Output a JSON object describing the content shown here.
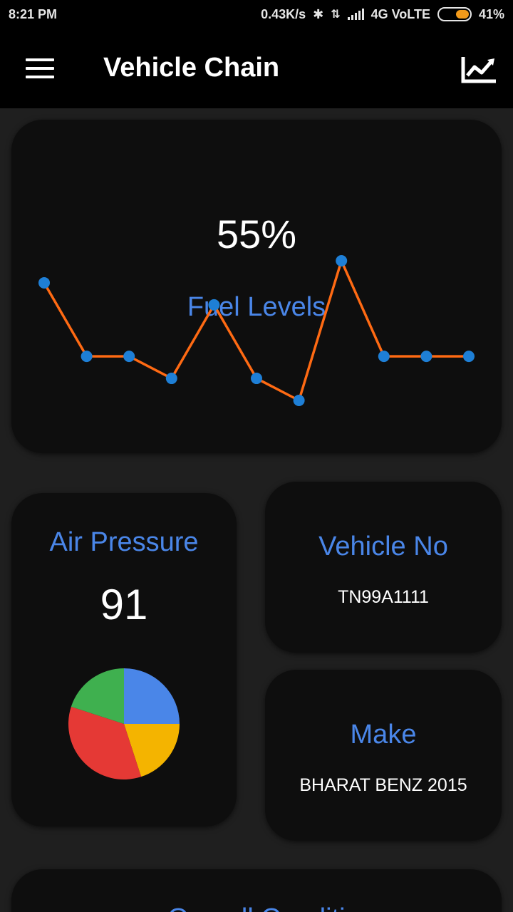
{
  "status_bar": {
    "time": "8:21 PM",
    "network_speed": "0.43K/s",
    "network_type": "4G VoLTE",
    "battery_percent": "41%"
  },
  "app_bar": {
    "title": "Vehicle Chain",
    "menu_icon": "hamburger-menu-icon",
    "chart_icon": "trending-chart-icon"
  },
  "fuel": {
    "title": "Fuel Levels",
    "value": "55%",
    "chart_data": {
      "type": "line",
      "values": [
        65,
        45,
        45,
        39,
        59,
        39,
        33,
        71,
        45,
        45,
        45
      ],
      "line_color": "#ff6a13",
      "point_color": "#1e7fd6",
      "grid": false
    }
  },
  "air_pressure": {
    "title": "Air Pressure",
    "value": "91",
    "chart_data": {
      "type": "pie",
      "values": [
        25,
        20,
        35,
        20
      ],
      "colors": [
        "#4a86e8",
        "#f4b400",
        "#e53935",
        "#3fb04f"
      ]
    }
  },
  "vehicle_no": {
    "title": "Vehicle No",
    "value": "TN99A1111"
  },
  "make": {
    "title": "Make",
    "value": "BHARAT BENZ 2015"
  },
  "overall": {
    "title": "Overall Conditi"
  },
  "colors": {
    "accent": "#4a86e8",
    "background": "#1f1f1f",
    "card": "#0e0e0e"
  }
}
